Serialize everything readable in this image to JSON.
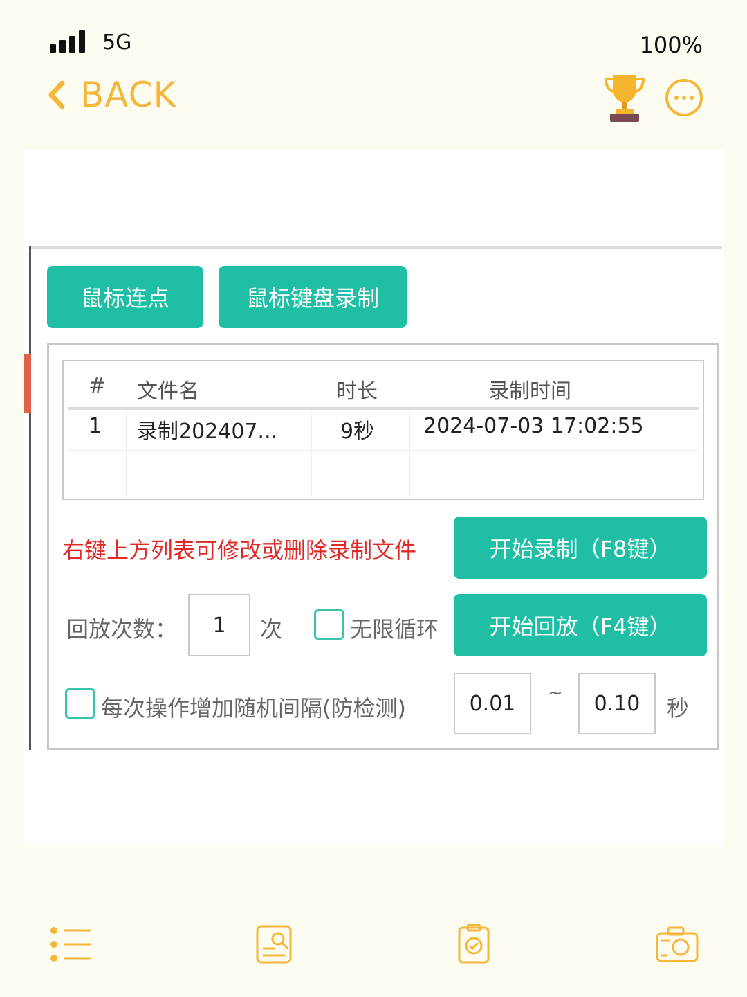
{
  "status_bar": {
    "network": "5G",
    "battery": "100%"
  },
  "nav": {
    "back_label": "BACK",
    "trophy_icon": "trophy-icon",
    "more_icon": "more-icon"
  },
  "tabs": {
    "mouse_click": "鼠标连点",
    "mouse_keyboard_record": "鼠标键盘录制"
  },
  "table": {
    "headers": {
      "index": "#",
      "filename": "文件名",
      "duration": "时长",
      "record_time": "录制时间"
    },
    "rows": [
      {
        "index": "1",
        "filename": "录制202407...",
        "duration": "9秒",
        "record_time": "2024-07-03 17:02:55"
      }
    ]
  },
  "hint": "右键上方列表可修改或删除录制文件",
  "buttons": {
    "start_record": "开始录制（F8键）",
    "start_playback": "开始回放（F4键）"
  },
  "playback": {
    "count_label": "回放次数：",
    "count_value": "1",
    "count_unit": "次",
    "infinite_loop_label": "无限循环",
    "infinite_loop_checked": false
  },
  "random_interval": {
    "label": "每次操作增加随机间隔(防检测)",
    "checked": false,
    "min": "0.01",
    "separator": "~",
    "max": "0.10",
    "unit": "秒"
  },
  "colors": {
    "accent": "#f4b73a",
    "button": "#20bfa5",
    "hint": "#e02a2a",
    "background": "#fdfcf1"
  },
  "toolbar_icons": [
    "list-icon",
    "search-document-icon",
    "clipboard-check-icon",
    "camera-icon"
  ]
}
